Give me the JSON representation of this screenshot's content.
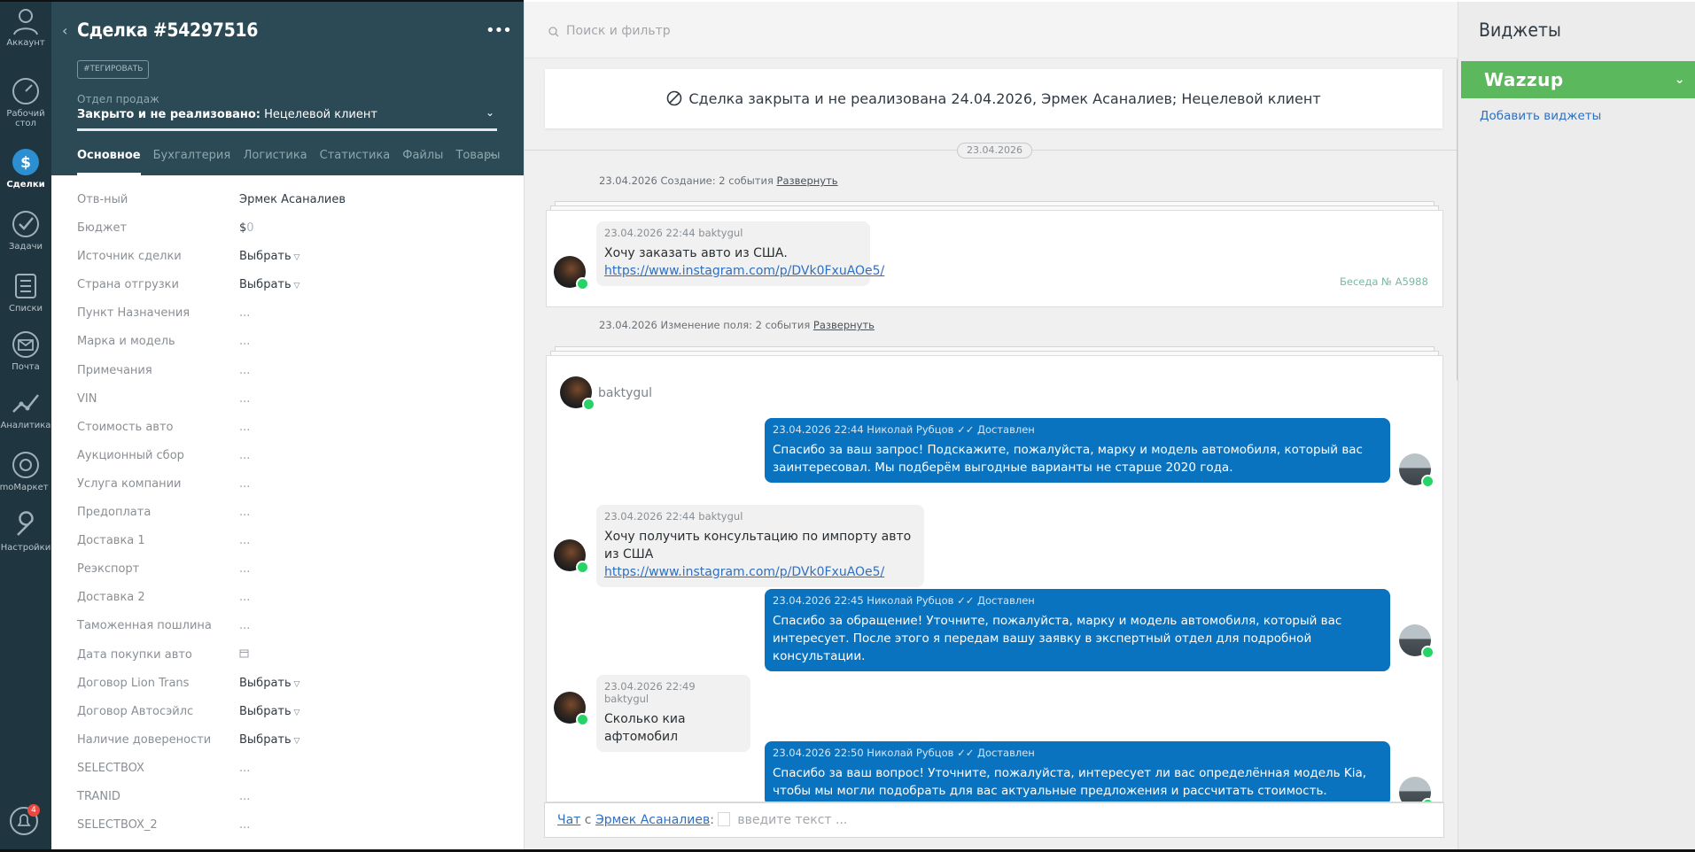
{
  "nav": {
    "items": [
      {
        "label": "Аккаунт",
        "icon": "account-icon"
      },
      {
        "label": "Рабочий стол",
        "icon": "dashboard-icon"
      },
      {
        "label": "Сделки",
        "icon": "deals-icon",
        "active": true
      },
      {
        "label": "Задачи",
        "icon": "tasks-icon"
      },
      {
        "label": "Списки",
        "icon": "lists-icon"
      },
      {
        "label": "Почта",
        "icon": "mail-icon"
      },
      {
        "label": "Аналитика",
        "icon": "analytics-icon"
      },
      {
        "label": "amoМаркет",
        "icon": "market-icon"
      },
      {
        "label": "Настройки",
        "icon": "settings-icon"
      }
    ],
    "notifications_count": "4"
  },
  "card": {
    "title": "Сделка #54297516",
    "tag_button": "#ТЕГИРОВАТЬ",
    "pipeline_label": "Отдел продаж",
    "status_bold": "Закрыто и не реализовано:",
    "status_reason": "Нецелевой клиент",
    "tabs": [
      "Основное",
      "Бухгалтерия",
      "Логистика",
      "Статистика",
      "Файлы",
      "Товары"
    ],
    "fields": [
      {
        "label": "Отв-ный",
        "value": "Эрмек Асаналиев",
        "type": "text"
      },
      {
        "label": "Бюджет",
        "value": "$",
        "extra": "0",
        "type": "budget"
      },
      {
        "label": "Источник сделки",
        "value": "Выбрать",
        "type": "select"
      },
      {
        "label": "Страна отгрузки",
        "value": "Выбрать",
        "type": "select"
      },
      {
        "label": "Пункт Назначения",
        "value": "...",
        "type": "empty"
      },
      {
        "label": "Марка и модель",
        "value": "...",
        "type": "empty"
      },
      {
        "label": "Примечания",
        "value": "...",
        "type": "empty"
      },
      {
        "label": "VIN",
        "value": "...",
        "type": "empty"
      },
      {
        "label": "Стоимость авто",
        "value": "...",
        "type": "empty"
      },
      {
        "label": "Аукционный сбор",
        "value": "...",
        "type": "empty"
      },
      {
        "label": "Услуга компании",
        "value": "...",
        "type": "empty"
      },
      {
        "label": "Предоплата",
        "value": "...",
        "type": "empty"
      },
      {
        "label": "Доставка 1",
        "value": "...",
        "type": "empty"
      },
      {
        "label": "Реэкспорт",
        "value": "...",
        "type": "empty"
      },
      {
        "label": "Доставка 2",
        "value": "...",
        "type": "empty"
      },
      {
        "label": "Таможенная пошлина",
        "value": "...",
        "type": "empty"
      },
      {
        "label": "Дата покупки авто",
        "value": "",
        "type": "date"
      },
      {
        "label": "Договор Lion Trans",
        "value": "Выбрать",
        "type": "select"
      },
      {
        "label": "Договор Автосэйлс",
        "value": "Выбрать",
        "type": "select"
      },
      {
        "label": "Наличие доверености",
        "value": "Выбрать",
        "type": "select"
      },
      {
        "label": "SELECTBOX",
        "value": "...",
        "type": "empty"
      },
      {
        "label": "TRANID",
        "value": "...",
        "type": "empty"
      },
      {
        "label": "SELECTBOX_2",
        "value": "...",
        "type": "empty"
      }
    ]
  },
  "feed": {
    "search_placeholder": "Поиск и фильтр",
    "closed_banner": "Сделка закрыта и не реализована 24.04.2026, Эрмек Асаналиев; Нецелевой клиент",
    "date_pill": "23.04.2026",
    "event1_text": "23.04.2026 Создание: 2 события",
    "event1_link": "Развернуть",
    "first_msg": {
      "meta": "23.04.2026 22:44 baktygul",
      "text": "Хочу заказать авто из США.",
      "link": "https://www.instagram.com/p/DVk0FxuAOe5/"
    },
    "conversation_number": "Беседа № A5988",
    "event2_text": "23.04.2026 Изменение поля: 2 события",
    "event2_link": "Развернуть",
    "sender_name": "baktygul",
    "messages": [
      {
        "dir": "out",
        "meta": "23.04.2026 22:44 Николай Рубцов",
        "status": "Доставлен",
        "text": "Спасибо за ваш запрос! Подскажите, пожалуйста, марку и модель автомобиля, который вас заинтересовал. Мы подберём выгодные варианты не старше 2020 года."
      },
      {
        "dir": "in",
        "meta": "23.04.2026 22:44 baktygul",
        "text": "Хочу получить консультацию по импорту авто из США",
        "link": "https://www.instagram.com/p/DVk0FxuAOe5/"
      },
      {
        "dir": "out",
        "meta": "23.04.2026 22:45 Николай Рубцов",
        "status": "Доставлен",
        "text": "Спасибо за обращение! Уточните, пожалуйста, марку и модель автомобиля, который вас интересует. После этого я передам вашу заявку в экспертный отдел для подробной консультации."
      },
      {
        "dir": "in",
        "meta": "23.04.2026 22:49 baktygul",
        "text": "Сколько киа афтомобил"
      },
      {
        "dir": "out",
        "meta": "23.04.2026 22:50 Николай Рубцов",
        "status": "Доставлен",
        "text": "Спасибо за ваш вопрос! Уточните, пожалуйста, интересует ли вас определённая модель Kia, чтобы мы могли подобрать для вас актуальные предложения и рассчитать стоимость."
      }
    ],
    "chat_input": {
      "chat_link": "Чат",
      "preposition": "с",
      "contact_link": "Эрмек Асаналиев",
      "colon": ":",
      "placeholder": "введите текст ..."
    }
  },
  "widgets": {
    "title": "Виджеты",
    "wazzup_label": "Wazzup",
    "add_widgets": "Добавить виджеты"
  },
  "colors": {
    "nav_bg": "#1f3540",
    "card_header": "#2b4a55",
    "out_bubble": "#0a73c0",
    "wazzup": "#5cb85c",
    "link": "#2e6fc1"
  }
}
